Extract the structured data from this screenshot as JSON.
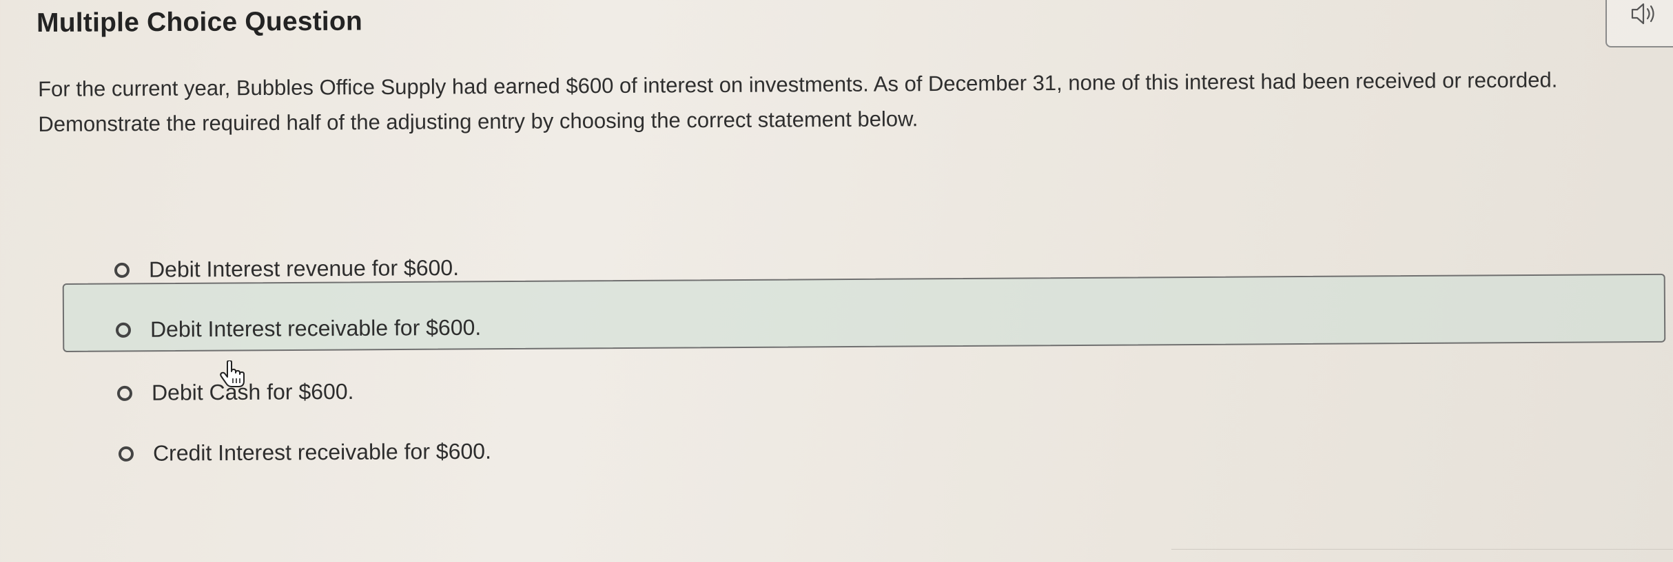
{
  "header": {
    "title": "Multiple Choice Question",
    "audio_icon": "speaker-icon"
  },
  "question": {
    "line1": "For the current year, Bubbles Office Supply had earned $600 of interest on investments. As of December 31, none of this interest had been received or recorded.",
    "line2": "Demonstrate the required half of the adjusting entry by choosing the correct statement below."
  },
  "options": [
    {
      "label": "Debit Interest revenue for $600."
    },
    {
      "label": "Debit Interest receivable for $600.",
      "hovered": true
    },
    {
      "label": "Debit Cash for $600."
    },
    {
      "label": "Credit Interest receivable for $600."
    }
  ],
  "cursor": {
    "icon": "hand-pointer-icon"
  },
  "colors": {
    "hover_background": "#d6e2db",
    "hover_border": "#6f6f6f",
    "radio_border": "#444444"
  }
}
